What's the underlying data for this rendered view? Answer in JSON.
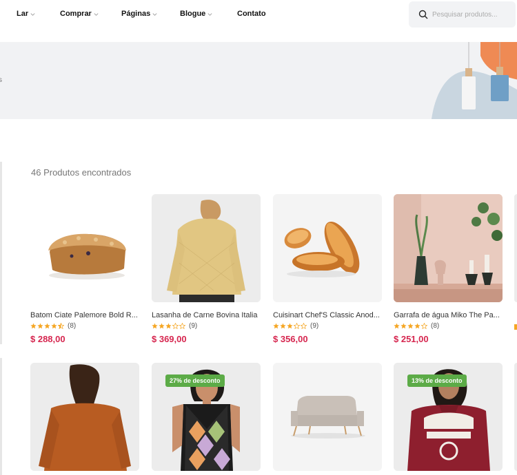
{
  "nav": {
    "items": [
      {
        "label": "Lar",
        "has_menu": true
      },
      {
        "label": "Comprar",
        "has_menu": true
      },
      {
        "label": "Páginas",
        "has_menu": true
      },
      {
        "label": "Blogue",
        "has_menu": true
      },
      {
        "label": "Contato",
        "has_menu": false
      }
    ],
    "search_placeholder": "Pesquisar produtos..."
  },
  "banner": {
    "text": "s"
  },
  "results": {
    "count_text": "46 Produtos encontrados"
  },
  "products": [
    {
      "name": "Batom Ciate Palemore Bold R...",
      "rating": 4.5,
      "reviews": "(8)",
      "price": "$ 288,00",
      "badge": ""
    },
    {
      "name": "Lasanha de Carne Bovina Italia",
      "rating": 3,
      "reviews": "(9)",
      "price": "$ 369,00",
      "badge": ""
    },
    {
      "name": "Cuisinart Chef'S Classic Anod...",
      "rating": 3,
      "reviews": "(9)",
      "price": "$ 356,00",
      "badge": ""
    },
    {
      "name": "Garrafa de água Miko The Pa...",
      "rating": 4,
      "reviews": "(8)",
      "price": "$ 251,00",
      "badge": ""
    },
    {
      "name": "",
      "rating": 0,
      "reviews": "",
      "price": "",
      "badge": ""
    },
    {
      "name": "",
      "rating": 0,
      "reviews": "",
      "price": "",
      "badge": "27% de desconto"
    },
    {
      "name": "",
      "rating": 0,
      "reviews": "",
      "price": "",
      "badge": ""
    },
    {
      "name": "",
      "rating": 0,
      "reviews": "",
      "price": "",
      "badge": "13% de desconto"
    }
  ],
  "colors": {
    "price": "#d6264f",
    "star": "#f5a623",
    "badge": "#5cab47"
  },
  "icons": {
    "search": "search-icon",
    "chevron": "chevron-down-icon",
    "star": "star-icon"
  }
}
